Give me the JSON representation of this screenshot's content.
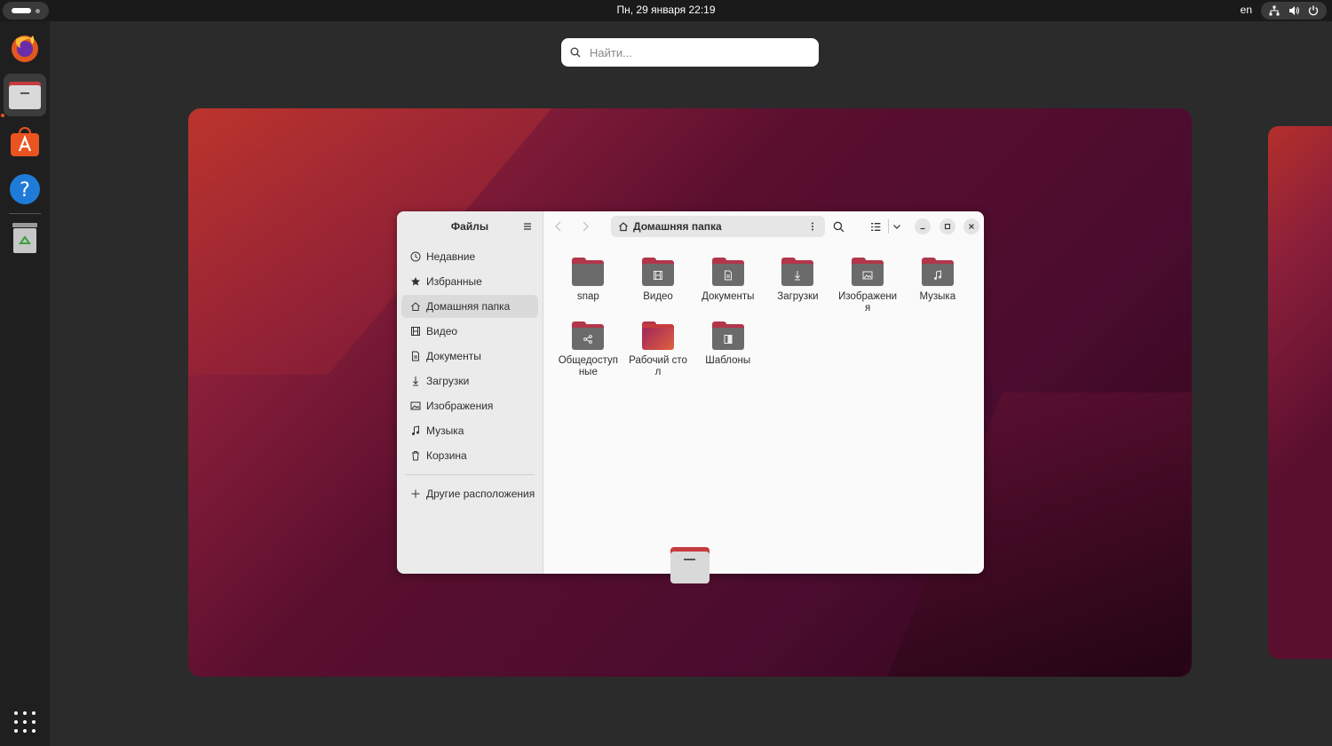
{
  "topbar": {
    "clock": "Пн, 29 января  22:19",
    "language": "en",
    "icons": [
      "network-icon",
      "volume-icon",
      "power-icon"
    ]
  },
  "dock": {
    "items": [
      "firefox",
      "files",
      "app-center",
      "help",
      "trash"
    ],
    "show_apps": "apps-grid-icon"
  },
  "search": {
    "placeholder": "Найти..."
  },
  "files_window": {
    "sidebar": {
      "title": "Файлы",
      "items": [
        {
          "label": "Недавние",
          "icon": "clock-icon"
        },
        {
          "label": "Избранные",
          "icon": "star-icon"
        },
        {
          "label": "Домашняя папка",
          "icon": "home-icon",
          "active": true
        },
        {
          "label": "Видео",
          "icon": "film-icon"
        },
        {
          "label": "Документы",
          "icon": "document-icon"
        },
        {
          "label": "Загрузки",
          "icon": "download-icon"
        },
        {
          "label": "Изображения",
          "icon": "image-icon"
        },
        {
          "label": "Музыка",
          "icon": "music-icon"
        },
        {
          "label": "Корзина",
          "icon": "trash-icon"
        }
      ],
      "other": "Другие расположения"
    },
    "path": "Домашняя папка",
    "folders": [
      {
        "label": "snap",
        "icon": "none"
      },
      {
        "label": "Видео",
        "icon": "film"
      },
      {
        "label": "Документы",
        "icon": "document"
      },
      {
        "label": "Загрузки",
        "icon": "download"
      },
      {
        "label": "Изображения",
        "icon": "image"
      },
      {
        "label": "Музыка",
        "icon": "music"
      },
      {
        "label": "Общедоступные",
        "icon": "share"
      },
      {
        "label": "Рабочий стол",
        "icon": "desktop"
      },
      {
        "label": "Шаблоны",
        "icon": "template"
      }
    ]
  },
  "colors": {
    "accent": "#e95420",
    "folder_tab": "#b2364a",
    "folder_body": "#6b6b6b"
  }
}
